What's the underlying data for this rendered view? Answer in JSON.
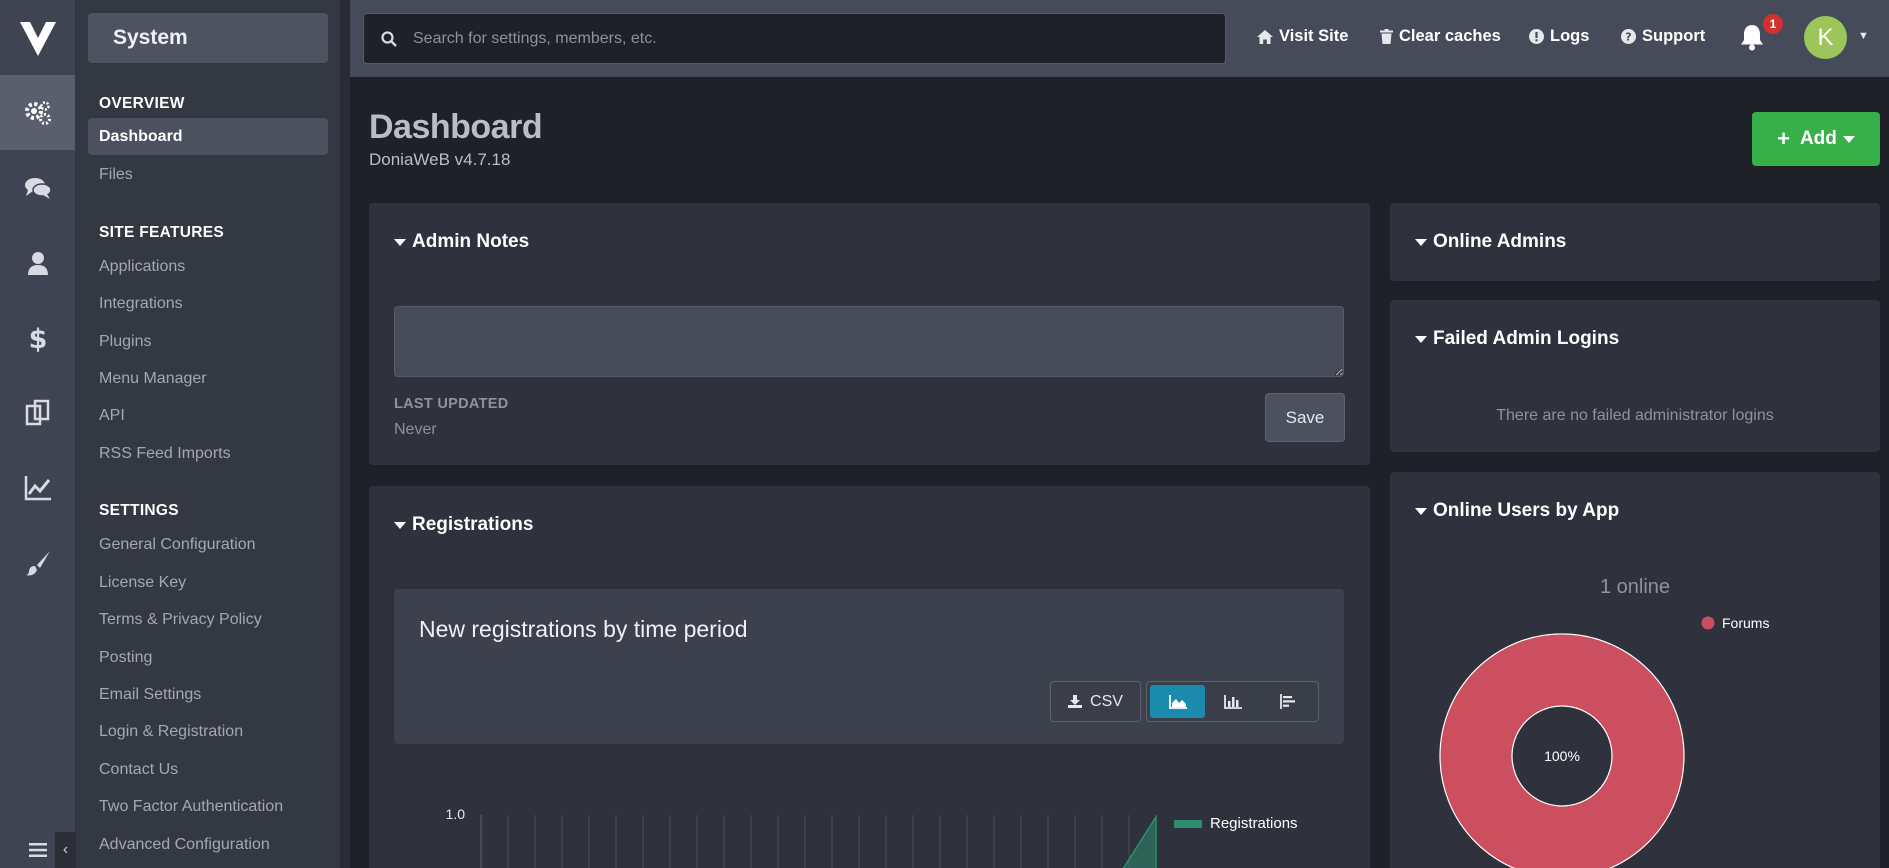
{
  "sidebar": {
    "system_label": "System",
    "sections": [
      {
        "heading": "OVERVIEW",
        "items": [
          "Dashboard",
          "Files"
        ]
      },
      {
        "heading": "SITE FEATURES",
        "items": [
          "Applications",
          "Integrations",
          "Plugins",
          "Menu Manager",
          "API",
          "RSS Feed Imports"
        ]
      },
      {
        "heading": "SETTINGS",
        "items": [
          "General Configuration",
          "License Key",
          "Terms & Privacy Policy",
          "Posting",
          "Email Settings",
          "Login & Registration",
          "Contact Us",
          "Two Factor Authentication",
          "Advanced Configuration"
        ]
      }
    ],
    "active_item": "Dashboard"
  },
  "rail": {
    "icons": [
      "gears-icon",
      "chat-icon",
      "user-icon",
      "dollar-icon",
      "copy-icon",
      "chart-line-icon",
      "brush-icon"
    ],
    "active_icon": "gears-icon"
  },
  "topbar": {
    "search_placeholder": "Search for settings, members, etc.",
    "links": {
      "visit_site": "Visit Site",
      "clear_caches": "Clear caches",
      "logs": "Logs",
      "support": "Support"
    },
    "notification_count": "1",
    "avatar_initial": "K"
  },
  "page": {
    "title": "Dashboard",
    "subtitle": "DoniaWeB v4.7.18",
    "add_label": "Add"
  },
  "admin_notes": {
    "title": "Admin Notes",
    "last_updated_label": "LAST UPDATED",
    "last_updated_value": "Never",
    "save_label": "Save"
  },
  "registrations": {
    "title": "Registrations",
    "chart_title": "New registrations by time period",
    "csv_label": "CSV"
  },
  "online_admins": {
    "title": "Online Admins"
  },
  "failed_logins": {
    "title": "Failed Admin Logins",
    "empty_text": "There are no failed administrator logins"
  },
  "online_users": {
    "title": "Online Users by App",
    "count_text": "1 online",
    "percent_label": "100%"
  },
  "chart_data": [
    {
      "type": "area",
      "title": "",
      "series": [
        {
          "name": "Registrations",
          "color": "#2e8b6e"
        }
      ],
      "y_tick_labels": [
        "1.0"
      ],
      "legend_position": "top-right"
    },
    {
      "type": "pie",
      "title": "1 online",
      "categories": [
        "Forums"
      ],
      "values": [
        100
      ],
      "colors": [
        "#cc4f5f"
      ],
      "data_labels": [
        "100%"
      ],
      "legend_position": "top-right"
    }
  ],
  "colors": {
    "accent_green": "#38b04a",
    "accent_blue": "#1a8aad",
    "badge_red": "#d0312d",
    "pie_red": "#cc4f5f"
  }
}
